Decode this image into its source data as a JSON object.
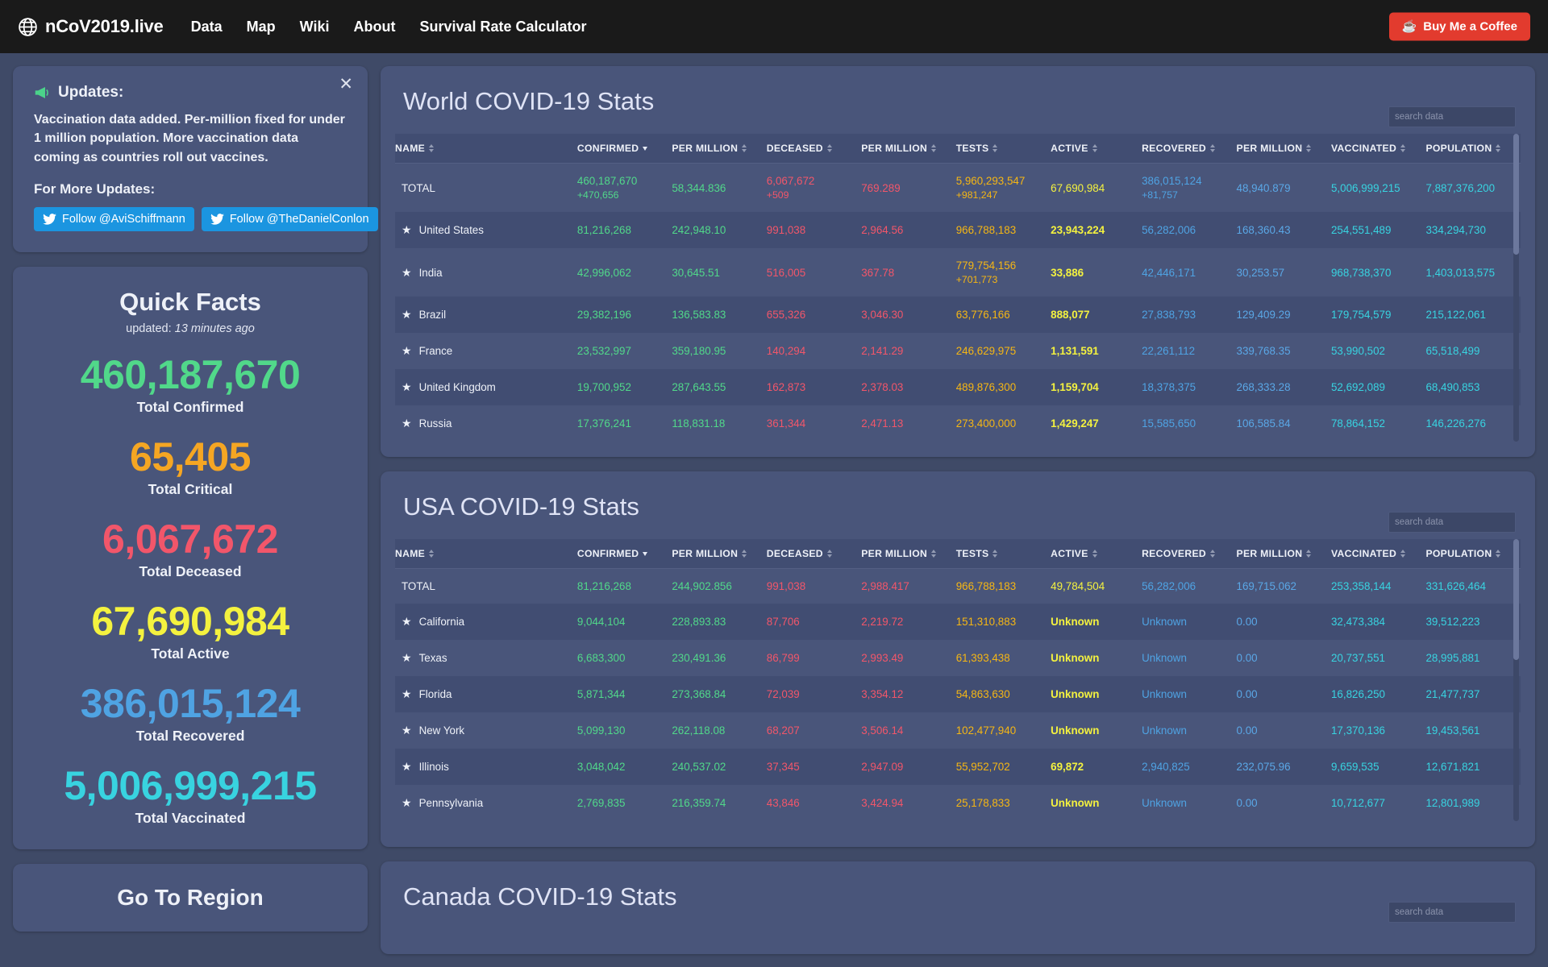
{
  "navbar": {
    "brand": "nCoV2019.live",
    "brand_icon": "globe-icon",
    "links": [
      "Data",
      "Map",
      "Wiki",
      "About",
      "Survival Rate Calculator"
    ],
    "coffee_button": "Buy Me a Coffee",
    "coffee_icon": "coffee-cup-icon",
    "background": "#1a1a1a",
    "coffee_color": "#e23b2e"
  },
  "updates": {
    "icon": "megaphone-icon",
    "title": "Updates:",
    "body": "Vaccination data added. Per-million fixed for under 1 million population. More vaccination data coming as countries roll out vaccines.",
    "more_label": "For More Updates:",
    "close_label": "✕",
    "twitter_buttons": [
      {
        "label": "Follow @AviSchiffmann",
        "icon": "twitter-bird-icon"
      },
      {
        "label": "Follow @TheDanielConlon",
        "icon": "twitter-bird-icon"
      }
    ],
    "twitter_color": "#1b95e0"
  },
  "quick_facts": {
    "title": "Quick Facts",
    "updated_prefix": "updated:",
    "updated_value": "13 minutes ago",
    "stats": [
      {
        "value": "460,187,670",
        "label": "Total Confirmed",
        "color": "#51d88a"
      },
      {
        "value": "65,405",
        "label": "Total Critical",
        "color": "#f5a623"
      },
      {
        "value": "6,067,672",
        "label": "Total Deceased",
        "color": "#f2566a"
      },
      {
        "value": "67,690,984",
        "label": "Total Active",
        "color": "#f4f23f"
      },
      {
        "value": "386,015,124",
        "label": "Total Recovered",
        "color": "#4fa3e3"
      },
      {
        "value": "5,006,999,215",
        "label": "Total Vaccinated",
        "color": "#38d3e0"
      }
    ]
  },
  "region": {
    "title": "Go To Region"
  },
  "tables": {
    "columns": [
      "NAME",
      "CONFIRMED",
      "PER MILLION",
      "DECEASED",
      "PER MILLION",
      "TESTS",
      "ACTIVE",
      "RECOVERED",
      "PER MILLION",
      "VACCINATED",
      "POPULATION"
    ],
    "sorted_column": "CONFIRMED",
    "sort_direction": "desc",
    "search_placeholder": "search data",
    "world": {
      "title": "World COVID-19 Stats",
      "rows": [
        {
          "name": "TOTAL",
          "star": false,
          "confirmed": "460,187,670",
          "confirmed_delta": "+470,656",
          "confirmed_pm": "58,344.836",
          "deceased": "6,067,672",
          "deceased_delta": "+509",
          "deceased_pm": "769.289",
          "tests": "5,960,293,547",
          "tests_delta": "+981,247",
          "active": "67,690,984",
          "recovered": "386,015,124",
          "recovered_delta": "+81,757",
          "recovered_pm": "48,940.879",
          "vaccinated": "5,006,999,215",
          "population": "7,887,376,200"
        },
        {
          "name": "United States",
          "star": true,
          "confirmed": "81,216,268",
          "confirmed_pm": "242,948.10",
          "deceased": "991,038",
          "deceased_pm": "2,964.56",
          "tests": "966,788,183",
          "active": "23,943,224",
          "recovered": "56,282,006",
          "recovered_pm": "168,360.43",
          "vaccinated": "254,551,489",
          "population": "334,294,730"
        },
        {
          "name": "India",
          "star": true,
          "confirmed": "42,996,062",
          "confirmed_pm": "30,645.51",
          "deceased": "516,005",
          "deceased_pm": "367.78",
          "tests": "779,754,156",
          "tests_delta": "+701,773",
          "active": "33,886",
          "recovered": "42,446,171",
          "recovered_pm": "30,253.57",
          "vaccinated": "968,738,370",
          "population": "1,403,013,575"
        },
        {
          "name": "Brazil",
          "star": true,
          "confirmed": "29,382,196",
          "confirmed_pm": "136,583.83",
          "deceased": "655,326",
          "deceased_pm": "3,046.30",
          "tests": "63,776,166",
          "active": "888,077",
          "recovered": "27,838,793",
          "recovered_pm": "129,409.29",
          "vaccinated": "179,754,579",
          "population": "215,122,061"
        },
        {
          "name": "France",
          "star": true,
          "confirmed": "23,532,997",
          "confirmed_pm": "359,180.95",
          "deceased": "140,294",
          "deceased_pm": "2,141.29",
          "tests": "246,629,975",
          "active": "1,131,591",
          "recovered": "22,261,112",
          "recovered_pm": "339,768.35",
          "vaccinated": "53,990,502",
          "population": "65,518,499"
        },
        {
          "name": "United Kingdom",
          "star": true,
          "confirmed": "19,700,952",
          "confirmed_pm": "287,643.55",
          "deceased": "162,873",
          "deceased_pm": "2,378.03",
          "tests": "489,876,300",
          "active": "1,159,704",
          "recovered": "18,378,375",
          "recovered_pm": "268,333.28",
          "vaccinated": "52,692,089",
          "population": "68,490,853"
        },
        {
          "name": "Russia",
          "star": true,
          "confirmed": "17,376,241",
          "confirmed_pm": "118,831.18",
          "deceased": "361,344",
          "deceased_pm": "2,471.13",
          "tests": "273,400,000",
          "active": "1,429,247",
          "recovered": "15,585,650",
          "recovered_pm": "106,585.84",
          "vaccinated": "78,864,152",
          "population": "146,226,276"
        }
      ]
    },
    "usa": {
      "title": "USA COVID-19 Stats",
      "rows": [
        {
          "name": "TOTAL",
          "star": false,
          "confirmed": "81,216,268",
          "confirmed_pm": "244,902.856",
          "deceased": "991,038",
          "deceased_pm": "2,988.417",
          "tests": "966,788,183",
          "active": "49,784,504",
          "recovered": "56,282,006",
          "recovered_pm": "169,715.062",
          "vaccinated": "253,358,144",
          "population": "331,626,464"
        },
        {
          "name": "California",
          "star": true,
          "confirmed": "9,044,104",
          "confirmed_pm": "228,893.83",
          "deceased": "87,706",
          "deceased_pm": "2,219.72",
          "tests": "151,310,883",
          "active": "Unknown",
          "recovered": "Unknown",
          "recovered_pm": "0.00",
          "vaccinated": "32,473,384",
          "population": "39,512,223"
        },
        {
          "name": "Texas",
          "star": true,
          "confirmed": "6,683,300",
          "confirmed_pm": "230,491.36",
          "deceased": "86,799",
          "deceased_pm": "2,993.49",
          "tests": "61,393,438",
          "active": "Unknown",
          "recovered": "Unknown",
          "recovered_pm": "0.00",
          "vaccinated": "20,737,551",
          "population": "28,995,881"
        },
        {
          "name": "Florida",
          "star": true,
          "confirmed": "5,871,344",
          "confirmed_pm": "273,368.84",
          "deceased": "72,039",
          "deceased_pm": "3,354.12",
          "tests": "54,863,630",
          "active": "Unknown",
          "recovered": "Unknown",
          "recovered_pm": "0.00",
          "vaccinated": "16,826,250",
          "population": "21,477,737"
        },
        {
          "name": "New York",
          "star": true,
          "confirmed": "5,099,130",
          "confirmed_pm": "262,118.08",
          "deceased": "68,207",
          "deceased_pm": "3,506.14",
          "tests": "102,477,940",
          "active": "Unknown",
          "recovered": "Unknown",
          "recovered_pm": "0.00",
          "vaccinated": "17,370,136",
          "population": "19,453,561"
        },
        {
          "name": "Illinois",
          "star": true,
          "confirmed": "3,048,042",
          "confirmed_pm": "240,537.02",
          "deceased": "37,345",
          "deceased_pm": "2,947.09",
          "tests": "55,952,702",
          "active": "69,872",
          "recovered": "2,940,825",
          "recovered_pm": "232,075.96",
          "vaccinated": "9,659,535",
          "population": "12,671,821"
        },
        {
          "name": "Pennsylvania",
          "star": true,
          "confirmed": "2,769,835",
          "confirmed_pm": "216,359.74",
          "deceased": "43,846",
          "deceased_pm": "3,424.94",
          "tests": "25,178,833",
          "active": "Unknown",
          "recovered": "Unknown",
          "recovered_pm": "0.00",
          "vaccinated": "10,712,677",
          "population": "12,801,989"
        }
      ]
    },
    "canada": {
      "title": "Canada COVID-19 Stats"
    }
  }
}
